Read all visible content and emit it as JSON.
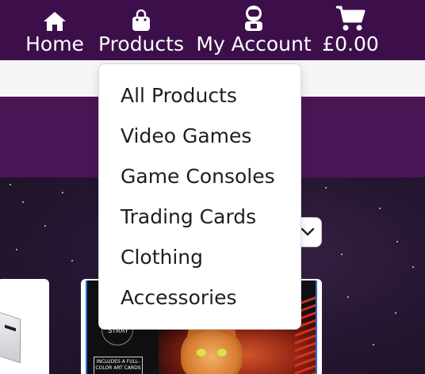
{
  "nav": {
    "home": {
      "label": "Home",
      "icon": "home-icon"
    },
    "products": {
      "label": "Products",
      "icon": "shopping-bag-icon"
    },
    "account": {
      "label": "My Account",
      "icon": "astronaut-icon"
    },
    "cart": {
      "label": "£0.00",
      "icon": "shopping-cart-icon"
    }
  },
  "products_menu": {
    "items": [
      {
        "label": "All Products"
      },
      {
        "label": "Video Games"
      },
      {
        "label": "Game Consoles"
      },
      {
        "label": "Trading Cards"
      },
      {
        "label": "Clothing"
      },
      {
        "label": "Accessories"
      }
    ]
  },
  "product_card": {
    "cover_logo": "STRAY",
    "cover_label": "INCLUDES A FULL-COLOR ART CARDS"
  },
  "colors": {
    "nav_bg": "#3d0f4a",
    "banner_bg": "#4a1555",
    "dropdown_bg": "#ffffff",
    "strip_bg": "#f5f4f6"
  }
}
